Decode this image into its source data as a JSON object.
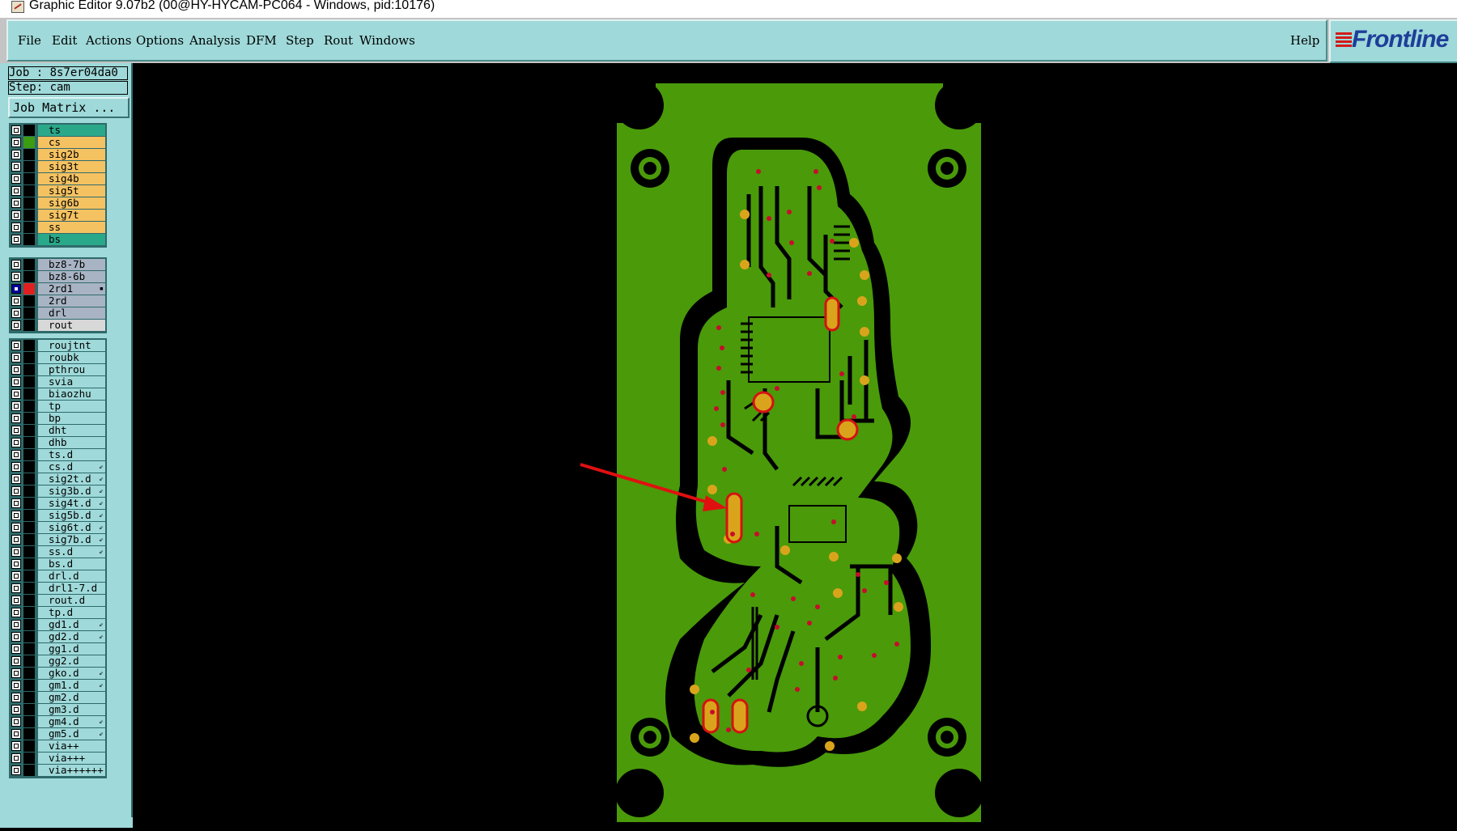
{
  "window": {
    "title": "Graphic Editor 9.07b2 (00@HY-HYCAM-PC064 - Windows, pid:10176)"
  },
  "menu": {
    "items": [
      "File",
      "Edit",
      "Actions",
      "Options",
      "Analysis",
      "DFM",
      "Step",
      "Rout",
      "Windows"
    ],
    "help": "Help"
  },
  "logo": {
    "text": "Frontline"
  },
  "job": {
    "label": "Job : 8s7er04da0",
    "step": "Step: cam",
    "matrix_button": "Job Matrix ..."
  },
  "layers": {
    "board": [
      {
        "name": "ts",
        "bg": "#2aa88a",
        "swatch": "#000000"
      },
      {
        "name": "cs",
        "bg": "#f5c262",
        "swatch": "#3c9c12"
      },
      {
        "name": "sig2b",
        "bg": "#f5c262",
        "swatch": "#000000"
      },
      {
        "name": "sig3t",
        "bg": "#f5c262",
        "swatch": "#000000"
      },
      {
        "name": "sig4b",
        "bg": "#f5c262",
        "swatch": "#000000"
      },
      {
        "name": "sig5t",
        "bg": "#f5c262",
        "swatch": "#000000"
      },
      {
        "name": "sig6b",
        "bg": "#f5c262",
        "swatch": "#000000"
      },
      {
        "name": "sig7t",
        "bg": "#f5c262",
        "swatch": "#000000"
      },
      {
        "name": "ss",
        "bg": "#f5c262",
        "swatch": "#000000"
      },
      {
        "name": "bs",
        "bg": "#2aa88a",
        "swatch": "#000000"
      }
    ],
    "drill": [
      {
        "name": "bz8-7b",
        "bg": "#a8b4c4",
        "swatch": "#000000"
      },
      {
        "name": "bz8-6b",
        "bg": "#a8b4c4",
        "swatch": "#000000"
      },
      {
        "name": "2rd1",
        "bg": "#a8b4c4",
        "swatch": "#e02020",
        "selected": true,
        "arrow": "▪"
      },
      {
        "name": "2rd",
        "bg": "#a8b4c4",
        "swatch": "#000000"
      },
      {
        "name": "drl",
        "bg": "#a8b4c4",
        "swatch": "#000000"
      },
      {
        "name": "rout",
        "bg": "#d8d8d8",
        "swatch": "#000000"
      }
    ],
    "misc": [
      {
        "name": "roujtnt",
        "bg": "#9fd9d9"
      },
      {
        "name": "roubk",
        "bg": "#9fd9d9"
      },
      {
        "name": "pthrou",
        "bg": "#9fd9d9"
      },
      {
        "name": "svia",
        "bg": "#9fd9d9"
      },
      {
        "name": "biaozhu",
        "bg": "#9fd9d9"
      },
      {
        "name": "tp",
        "bg": "#9fd9d9"
      },
      {
        "name": "bp",
        "bg": "#9fd9d9"
      },
      {
        "name": "dht",
        "bg": "#9fd9d9"
      },
      {
        "name": "dhb",
        "bg": "#9fd9d9"
      },
      {
        "name": "ts.d",
        "bg": "#9fd9d9"
      },
      {
        "name": "cs.d",
        "bg": "#9fd9d9",
        "arrow": "⇙"
      },
      {
        "name": "sig2t.d",
        "bg": "#9fd9d9",
        "arrow": "⇙"
      },
      {
        "name": "sig3b.d",
        "bg": "#9fd9d9",
        "arrow": "⇙"
      },
      {
        "name": "sig4t.d",
        "bg": "#9fd9d9",
        "arrow": "⇙"
      },
      {
        "name": "sig5b.d",
        "bg": "#9fd9d9",
        "arrow": "⇙"
      },
      {
        "name": "sig6t.d",
        "bg": "#9fd9d9",
        "arrow": "⇙"
      },
      {
        "name": "sig7b.d",
        "bg": "#9fd9d9",
        "arrow": "⇙"
      },
      {
        "name": "ss.d",
        "bg": "#9fd9d9",
        "arrow": "⇙"
      },
      {
        "name": "bs.d",
        "bg": "#9fd9d9"
      },
      {
        "name": "drl.d",
        "bg": "#9fd9d9"
      },
      {
        "name": "drl1-7.d",
        "bg": "#9fd9d9"
      },
      {
        "name": "rout.d",
        "bg": "#9fd9d9"
      },
      {
        "name": "tp.d",
        "bg": "#9fd9d9"
      },
      {
        "name": "gd1.d",
        "bg": "#9fd9d9",
        "arrow": "⇙"
      },
      {
        "name": "gd2.d",
        "bg": "#9fd9d9",
        "arrow": "⇙"
      },
      {
        "name": "gg1.d",
        "bg": "#9fd9d9"
      },
      {
        "name": "gg2.d",
        "bg": "#9fd9d9"
      },
      {
        "name": "gko.d",
        "bg": "#9fd9d9",
        "arrow": "⇙"
      },
      {
        "name": "gm1.d",
        "bg": "#9fd9d9",
        "arrow": "⇙"
      },
      {
        "name": "gm2.d",
        "bg": "#9fd9d9"
      },
      {
        "name": "gm3.d",
        "bg": "#9fd9d9"
      },
      {
        "name": "gm4.d",
        "bg": "#9fd9d9",
        "arrow": "⇙"
      },
      {
        "name": "gm5.d",
        "bg": "#9fd9d9",
        "arrow": "⇙"
      },
      {
        "name": "via++",
        "bg": "#9fd9d9"
      },
      {
        "name": "via+++",
        "bg": "#9fd9d9"
      },
      {
        "name": "via++++++",
        "bg": "#9fd9d9"
      }
    ]
  },
  "colors": {
    "copper": "#4a9a0a",
    "pad": "#d9a41c",
    "drill": "#d41212",
    "annotation_arrow": "#e01010"
  },
  "icons": [
    "app-icon",
    "frontline-logo",
    "board-view"
  ]
}
